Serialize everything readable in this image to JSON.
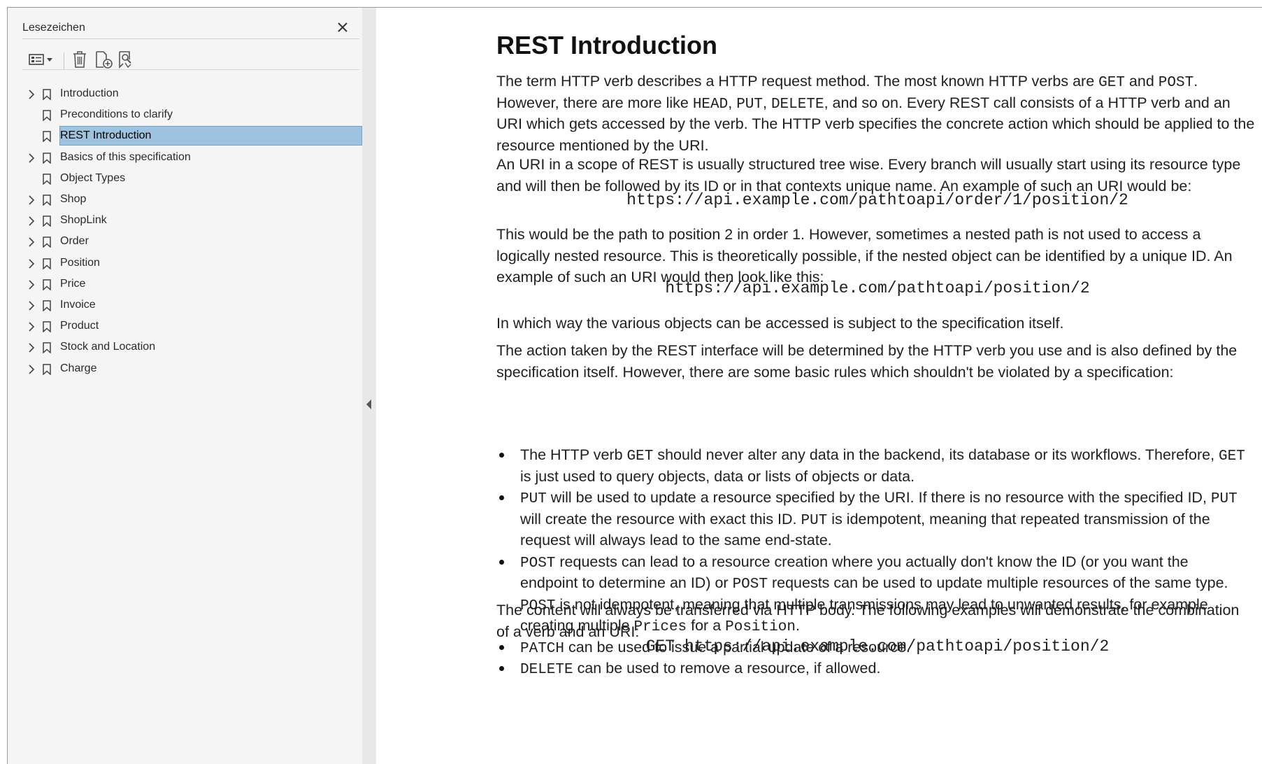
{
  "sidebar": {
    "title": "Lesezeichen",
    "items": [
      {
        "label": "Introduction",
        "expandable": true,
        "selected": false
      },
      {
        "label": "Preconditions to clarify",
        "expandable": false,
        "selected": false
      },
      {
        "label": "REST Introduction",
        "expandable": false,
        "selected": true
      },
      {
        "label": "Basics of this specification",
        "expandable": true,
        "selected": false
      },
      {
        "label": "Object Types",
        "expandable": false,
        "selected": false
      },
      {
        "label": "Shop",
        "expandable": true,
        "selected": false
      },
      {
        "label": "ShopLink",
        "expandable": true,
        "selected": false
      },
      {
        "label": "Order",
        "expandable": true,
        "selected": false
      },
      {
        "label": "Position",
        "expandable": true,
        "selected": false
      },
      {
        "label": "Price",
        "expandable": true,
        "selected": false
      },
      {
        "label": "Invoice",
        "expandable": true,
        "selected": false
      },
      {
        "label": "Product",
        "expandable": true,
        "selected": false
      },
      {
        "label": "Stock and Location",
        "expandable": true,
        "selected": false
      },
      {
        "label": "Charge",
        "expandable": true,
        "selected": false
      }
    ]
  },
  "document": {
    "title": "REST Introduction",
    "p1": [
      [
        "The term HTTP verb describes a HTTP request method. The most known HTTP verbs are ",
        "GET",
        " and ",
        "POST",
        "."
      ],
      [
        "However, there are more like ",
        "HEAD",
        ", ",
        "PUT",
        ", ",
        "DELETE",
        ", and so on. Every REST call consists of a HTTP verb and an"
      ],
      [
        "URI which gets accessed by the verb. The HTTP verb specifies the concrete action which should be applied to the"
      ],
      [
        "resource mentioned by the URI."
      ]
    ],
    "p2": [
      [
        "An URI in a scope of REST is usually structured tree wise. Every branch will usually start using its resource type"
      ],
      [
        "and will then be followed by its ID or in that contexts unique name. An example of such an URI would be:"
      ]
    ],
    "url1": "https://api.example.com/pathtoapi/order/1/position/2",
    "p3": [
      [
        "This would be the path to position 2 in order 1. However, sometimes a nested path is not used to access a"
      ],
      [
        "logically nested resource. This is theoretically possible, if the nested object can be identified by a unique ID. An"
      ],
      [
        "example of such an URI would then look like this:"
      ]
    ],
    "url2": "https://api.example.com/pathtoapi/position/2",
    "p4": [
      [
        "In which way the various objects can be accessed is subject to the specification itself."
      ]
    ],
    "p5": [
      [
        "The action taken by the REST interface will be determined by the HTTP verb you use and is also defined by the"
      ],
      [
        "specification itself. However, there are some basic rules which shouldn't be violated by a specification:"
      ]
    ],
    "bullets": [
      [
        [
          "The HTTP verb ",
          "GET",
          " should never alter any data in the backend, its database or its workflows. Therefore, ",
          "GET"
        ],
        [
          "is just used to query objects, data or lists of objects or data."
        ]
      ],
      [
        [
          "",
          "PUT",
          " will be used to update a resource specified by the URI. If there is no resource with the specified ID, ",
          "PUT"
        ],
        [
          "will create the resource with exact this ID. ",
          "PUT",
          " is idempotent, meaning that repeated transmission of the"
        ],
        [
          "request will always lead to the same end-state."
        ]
      ],
      [
        [
          "",
          "POST",
          " requests can lead to a resource creation where you actually don't know the ID (or you want the"
        ],
        [
          "endpoint to determine an ID) or ",
          "POST",
          " requests can be used to update multiple resources of the same type."
        ],
        [
          "",
          "POST",
          " is not idempotent, meaning that multiple transmissions may lead to unwanted results, for example"
        ],
        [
          "creating multiple ",
          "Prices",
          " for a ",
          "Position",
          "."
        ]
      ],
      [
        [
          "",
          "PATCH",
          " can be used to issue a partial update of a resource."
        ]
      ],
      [
        [
          "",
          "DELETE",
          " can be used to remove a resource, if allowed."
        ]
      ]
    ],
    "p6": [
      [
        "The content will always be transferred via HTTP body. The following examples will demonstrate the combination"
      ],
      [
        "of a verb and an URI:"
      ]
    ],
    "url3": "GET https://api.example.com/pathtoapi/position/2"
  },
  "colors": {
    "selection": "#9ec3de",
    "sidebar_bg": "#f5f5f5",
    "splitter_bg": "#e8e8e8"
  },
  "icons": [
    "close-icon",
    "options-icon",
    "delete-icon",
    "new-bookmark-icon",
    "find-bookmark-icon",
    "chevron-right-icon",
    "bookmark-icon",
    "collapse-panel-icon"
  ]
}
